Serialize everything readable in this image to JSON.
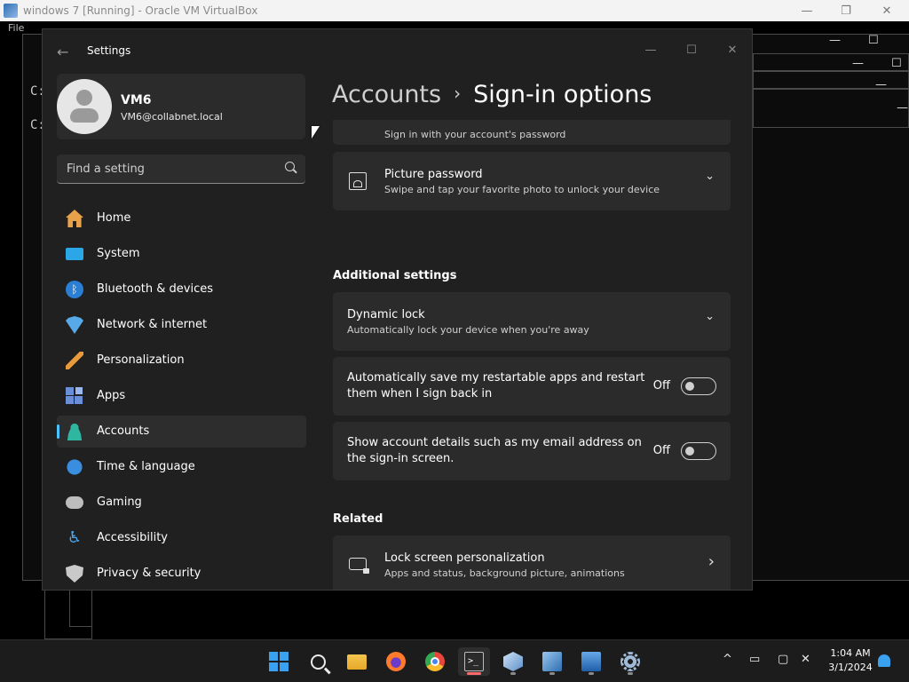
{
  "host": {
    "title": "windows 7 [Running] - Oracle VM VirtualBox",
    "menu_first": "File",
    "minimize": "—",
    "maximize": "❐",
    "close": "✕"
  },
  "console": {
    "line1": "C:",
    "line2": "C:"
  },
  "settings": {
    "title": "Settings",
    "back_glyph": "←",
    "minimize": "—",
    "maximize": "☐",
    "close": "✕",
    "profile": {
      "name": "VM6",
      "email": "VM6@collabnet.local"
    },
    "search": {
      "placeholder": "Find a setting"
    },
    "nav": [
      {
        "label": "Home",
        "icon": "home-icon"
      },
      {
        "label": "System",
        "icon": "monitor-icon"
      },
      {
        "label": "Bluetooth & devices",
        "icon": "bluetooth-icon",
        "glyph": "ᛒ"
      },
      {
        "label": "Network & internet",
        "icon": "wifi-icon"
      },
      {
        "label": "Personalization",
        "icon": "brush-icon"
      },
      {
        "label": "Apps",
        "icon": "apps-icon"
      },
      {
        "label": "Accounts",
        "icon": "person-icon",
        "active": true
      },
      {
        "label": "Time & language",
        "icon": "globe-clock-icon"
      },
      {
        "label": "Gaming",
        "icon": "controller-icon"
      },
      {
        "label": "Accessibility",
        "icon": "accessibility-icon",
        "glyph": "♿"
      },
      {
        "label": "Privacy & security",
        "icon": "shield-icon"
      }
    ],
    "breadcrumb": {
      "parent": "Accounts",
      "separator": "›",
      "current": "Sign-in options"
    },
    "content": {
      "password_partial_sub": "Sign in with your account's password",
      "picture_password": {
        "title": "Picture password",
        "sub": "Swipe and tap your favorite photo to unlock your device"
      },
      "additional_title": "Additional settings",
      "dynamic_lock": {
        "title": "Dynamic lock",
        "sub": "Automatically lock your device when you're away"
      },
      "auto_restart": {
        "line1": "Automatically save my restartable apps and restart",
        "line2": "them when I sign back in",
        "state": "Off"
      },
      "account_details": {
        "line1": "Show account details such as my email address on",
        "line2": "the sign-in screen.",
        "state": "Off"
      },
      "related_title": "Related",
      "lock_screen": {
        "title": "Lock screen personalization",
        "sub": "Apps and status, background picture, animations"
      },
      "chevron_down": "⌄",
      "chevron_right": "›"
    }
  },
  "taskbar": {
    "apps": [
      "start-icon",
      "search-icon",
      "file-explorer-icon",
      "firefox-icon",
      "chrome-icon",
      "terminal-icon",
      "virtualbox-icon",
      "vm-windows7-icon",
      "remote-desktop-icon",
      "settings-gear-icon"
    ],
    "terminal_glyph": ">_",
    "tray_chevron": "^",
    "time": "1:04 AM",
    "date": "3/1/2024"
  }
}
